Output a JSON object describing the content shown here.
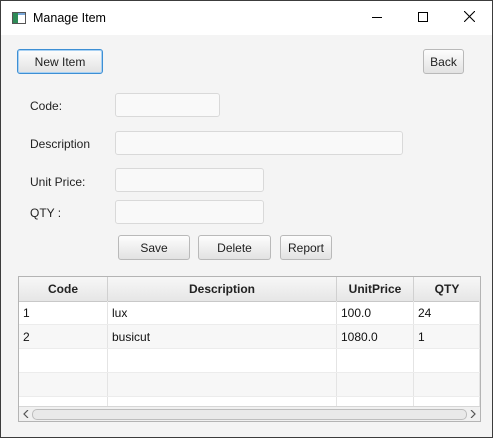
{
  "window": {
    "title": "Manage Item",
    "icons": {
      "app": "app-window-icon",
      "minimize": "minimize-icon",
      "maximize": "maximize-icon",
      "close": "close-icon"
    }
  },
  "toolbar": {
    "new_item_label": "New Item",
    "back_label": "Back"
  },
  "form": {
    "code_label": "Code:",
    "description_label": "Description",
    "unit_price_label": "Unit Price:",
    "qty_label": "QTY :",
    "code_value": "",
    "description_value": "",
    "unit_price_value": "",
    "qty_value": ""
  },
  "actions": {
    "save_label": "Save",
    "delete_label": "Delete",
    "report_label": "Report"
  },
  "table": {
    "columns": [
      "Code",
      "Description",
      "UnitPrice",
      "QTY"
    ],
    "rows": [
      [
        "1",
        "lux",
        "100.0",
        "24"
      ],
      [
        "2",
        "busicut",
        "1080.0",
        "1"
      ]
    ]
  },
  "colors": {
    "accent": "#3d8fd4",
    "window_bg": "#f4f4f4",
    "titlebar_bg": "#ffffff"
  }
}
